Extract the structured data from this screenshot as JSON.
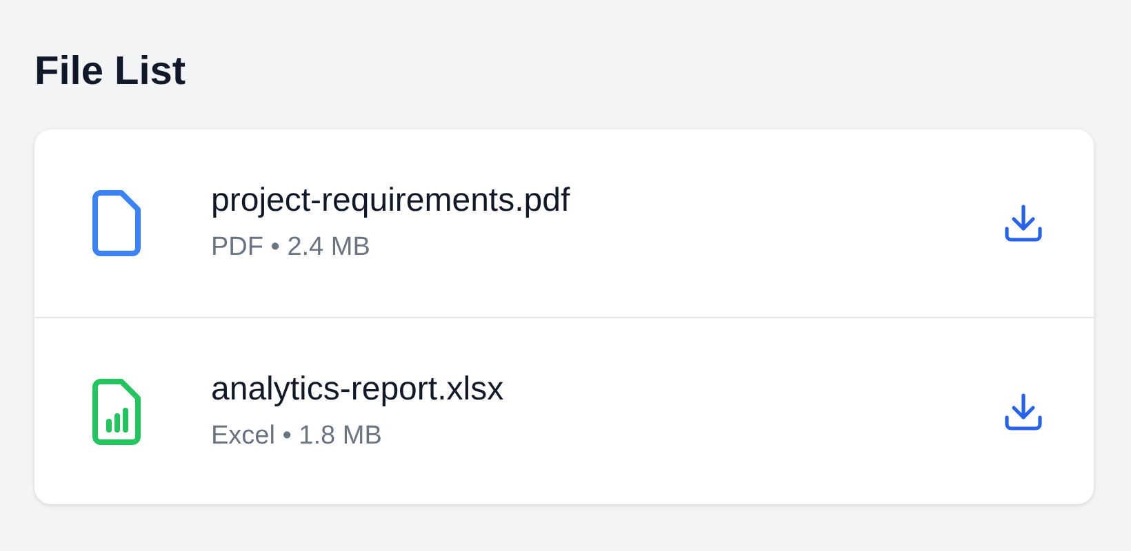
{
  "title": "File List",
  "files": [
    {
      "name": "project-requirements.pdf",
      "meta": "PDF • 2.4 MB",
      "kind": "document",
      "color": "#3b82f6"
    },
    {
      "name": "analytics-report.xlsx",
      "meta": "Excel • 1.8 MB",
      "kind": "spreadsheet",
      "color": "#22c55e"
    }
  ]
}
